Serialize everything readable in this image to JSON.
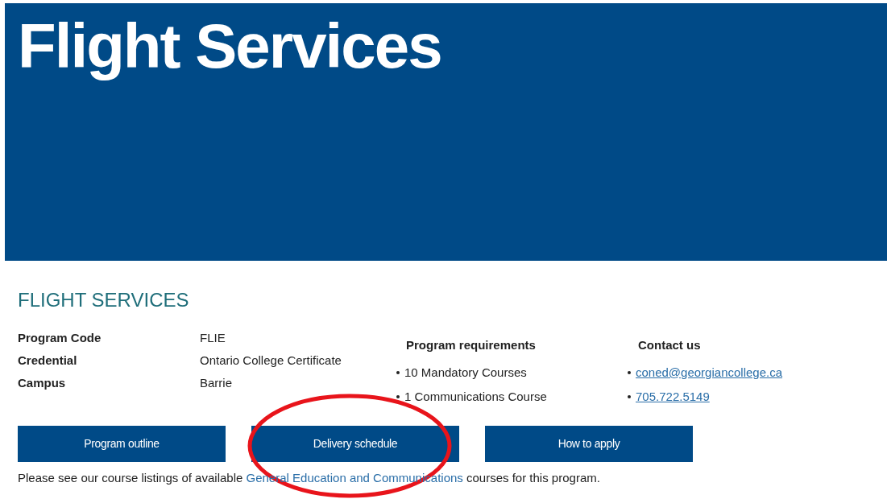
{
  "banner": {
    "title": "Flight Services"
  },
  "heading": "FLIGHT SERVICES",
  "details": [
    {
      "label": "Program Code",
      "value": "FLIE"
    },
    {
      "label": "Credential",
      "value": "Ontario College Certificate"
    },
    {
      "label": "Campus",
      "value": "Barrie"
    }
  ],
  "requirements": {
    "title": "Program requirements",
    "items": [
      "10 Mandatory Courses",
      "1 Communications Course"
    ]
  },
  "contact": {
    "title": "Contact us",
    "links": [
      "coned@georgiancollege.ca",
      "705.722.5149"
    ]
  },
  "buttons": [
    "Program outline",
    "Delivery schedule",
    "How to apply"
  ],
  "note": {
    "before": "Please see our course listings of available ",
    "link": "General Education and Communications",
    "after": " courses for this program."
  },
  "highlight": {
    "kind": "ellipse"
  }
}
